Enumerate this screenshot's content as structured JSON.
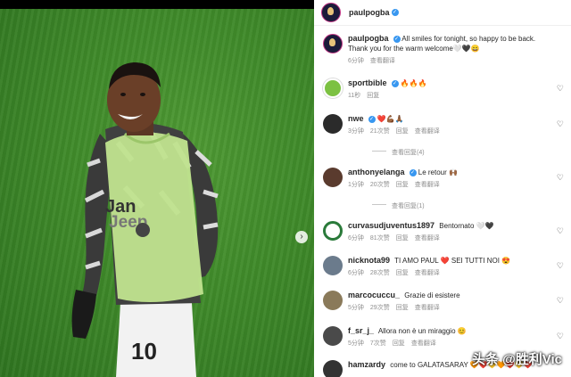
{
  "post": {
    "author": "paulpogba",
    "caption": "All smiles for tonight, so happy to be back. Thank you for the warm welcome🤍🖤😄",
    "time": "6分钟",
    "translate": "查看翻译"
  },
  "photo": {
    "next_icon": "›"
  },
  "comments": [
    {
      "user": "sportbible",
      "verified": true,
      "text": "🔥🔥🔥",
      "time": "11秒",
      "likes": "",
      "reply": "回复",
      "translate": "",
      "avatar_color": "#7cc142"
    },
    {
      "user": "nwe",
      "verified": true,
      "text": "❤️💪🏾🙏🏾",
      "time": "3分钟",
      "likes": "21次赞",
      "reply": "回复",
      "translate": "查看翻译",
      "avatar_color": "#2b2b2b"
    },
    {
      "user": "anthonyelanga",
      "verified": true,
      "text": "Le retour 🙌🏾",
      "time": "1分钟",
      "likes": "20次赞",
      "reply": "回复",
      "translate": "查看翻译",
      "avatar_color": "#5a3b2e"
    },
    {
      "user": "curvasudjuventus1897",
      "verified": false,
      "text": "Bentornato 🤍🖤",
      "time": "6分钟",
      "likes": "81次赞",
      "reply": "回复",
      "translate": "查看翻译",
      "avatar_color": "#2a7a3a"
    },
    {
      "user": "nicknota99",
      "verified": false,
      "text": "TI AMO PAUL ❤️ SEI TUTTI NOI 😍",
      "time": "6分钟",
      "likes": "28次赞",
      "reply": "回复",
      "translate": "查看翻译",
      "avatar_color": "#6b7b8c"
    },
    {
      "user": "marcocuccu_",
      "verified": false,
      "text": "Grazie di esistere",
      "time": "5分钟",
      "likes": "29次赞",
      "reply": "回复",
      "translate": "查看翻译",
      "avatar_color": "#8a7a5a"
    },
    {
      "user": "f_sr_j_",
      "verified": false,
      "text": "Allora non è un miraggio 😊",
      "time": "5分钟",
      "likes": "7次赞",
      "reply": "回复",
      "translate": "查看翻译",
      "avatar_color": "#4a4a4a"
    },
    {
      "user": "hamzardy",
      "verified": false,
      "text": "come to GALATASARAY 🧡❤️💛🧡❤️💛❤️",
      "time": "",
      "likes": "",
      "reply": "",
      "translate": "",
      "avatar_color": "#333333"
    }
  ],
  "view_replies": [
    "查看回复(4)",
    "查看回复(1)"
  ],
  "like_icon": "♡",
  "watermark": "头条 @胜利Vic"
}
